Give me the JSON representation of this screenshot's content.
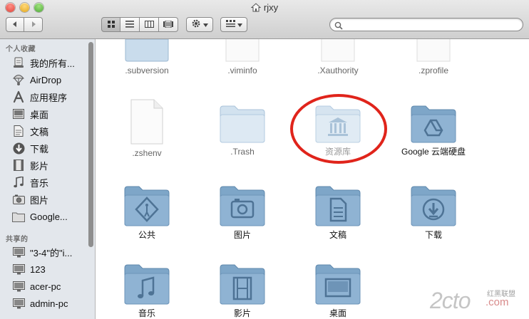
{
  "window": {
    "title": "rjxy"
  },
  "toolbar": {
    "back_label": "◀",
    "forward_label": "▶",
    "search_placeholder": "",
    "icons": [
      "back-arrow-icon",
      "forward-arrow-icon",
      "icon-view-icon",
      "list-view-icon",
      "column-view-icon",
      "cover-flow-icon",
      "gear-icon",
      "arrange-icon",
      "search-icon"
    ]
  },
  "sidebar": {
    "favorites_header": "个人收藏",
    "favorites": [
      {
        "label": "我的所有...",
        "icon": "all-files-icon"
      },
      {
        "label": "AirDrop",
        "icon": "airdrop-icon"
      },
      {
        "label": "应用程序",
        "icon": "applications-icon"
      },
      {
        "label": "桌面",
        "icon": "desktop-icon"
      },
      {
        "label": "文稿",
        "icon": "documents-icon"
      },
      {
        "label": "下载",
        "icon": "downloads-icon"
      },
      {
        "label": "影片",
        "icon": "movies-icon"
      },
      {
        "label": "音乐",
        "icon": "music-icon"
      },
      {
        "label": "图片",
        "icon": "pictures-icon"
      },
      {
        "label": "Google...",
        "icon": "folder-icon"
      }
    ],
    "shared_header": "共享的",
    "shared": [
      {
        "label": "\"3-4\"的\"i...",
        "icon": "computer-icon"
      },
      {
        "label": "123",
        "icon": "computer-icon"
      },
      {
        "label": "acer-pc",
        "icon": "computer-icon"
      },
      {
        "label": "admin-pc",
        "icon": "computer-icon"
      }
    ]
  },
  "files": {
    "row1": [
      ".subversion",
      ".viminfo",
      ".Xauthority",
      ".zprofile"
    ],
    "row2": [
      ".zshenv",
      ".Trash",
      "资源库",
      "Google 云端硬盘"
    ],
    "row3": [
      "公共",
      "图片",
      "文稿",
      "下载"
    ],
    "row4": [
      "音乐",
      "影片",
      "桌面"
    ]
  },
  "watermark": {
    "brand": "2cto",
    "domain": ".com",
    "tag": "红黑联盟"
  },
  "colors": {
    "folder_fill": "#8fb3d3",
    "annotation": "#e0241b"
  }
}
